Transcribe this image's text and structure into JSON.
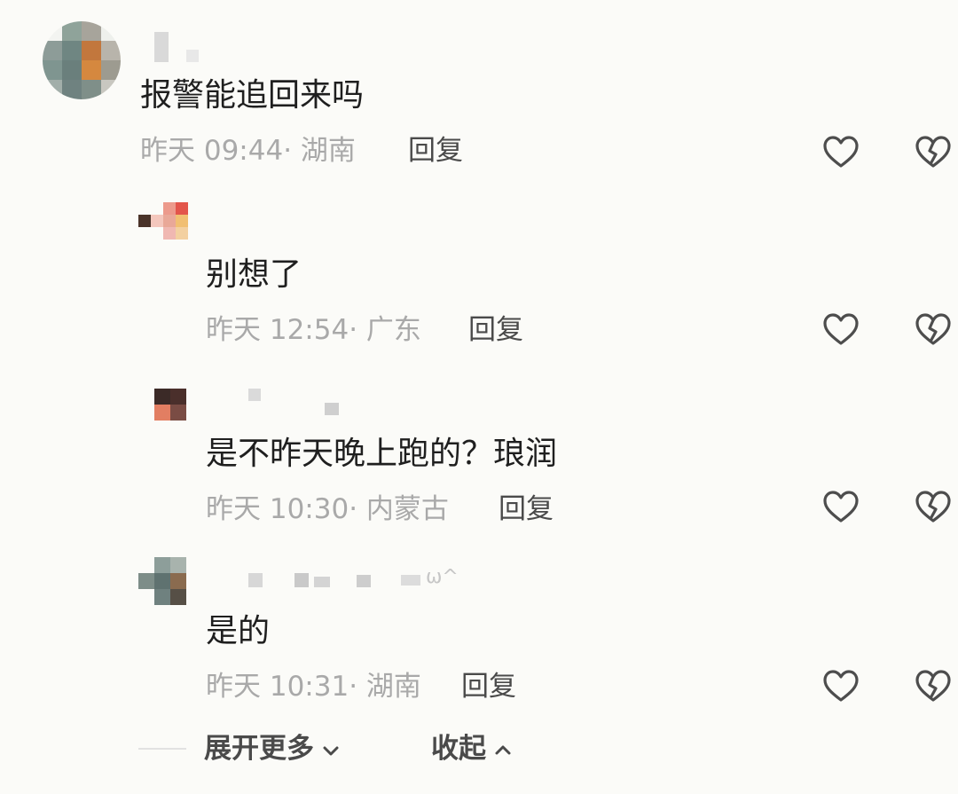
{
  "comments": [
    {
      "text": "报警能追回来吗",
      "time": "昨天 09:44",
      "location": "湖南",
      "reply_label": "回复"
    },
    {
      "text": "别想了",
      "time": "昨天 12:54",
      "location": "广东",
      "reply_label": "回复"
    },
    {
      "text": "是不昨天晚上跑的？琅润",
      "time": "昨天 10:30",
      "location": "内蒙古",
      "reply_label": "回复"
    },
    {
      "text": "是的",
      "time": "昨天 10:31",
      "location": "湖南",
      "reply_label": "回复"
    }
  ],
  "footer": {
    "expand_label": "展开更多",
    "collapse_label": "收起"
  },
  "colors": {
    "background": "#fbfbf8",
    "text": "#1f1f1f",
    "meta": "#a9a9a9",
    "icon": "#4d4d4d"
  },
  "icons": {
    "like": "heart-outline-icon",
    "dislike": "broken-heart-icon",
    "expand": "chevron-down-icon",
    "collapse": "chevron-up-icon"
  }
}
